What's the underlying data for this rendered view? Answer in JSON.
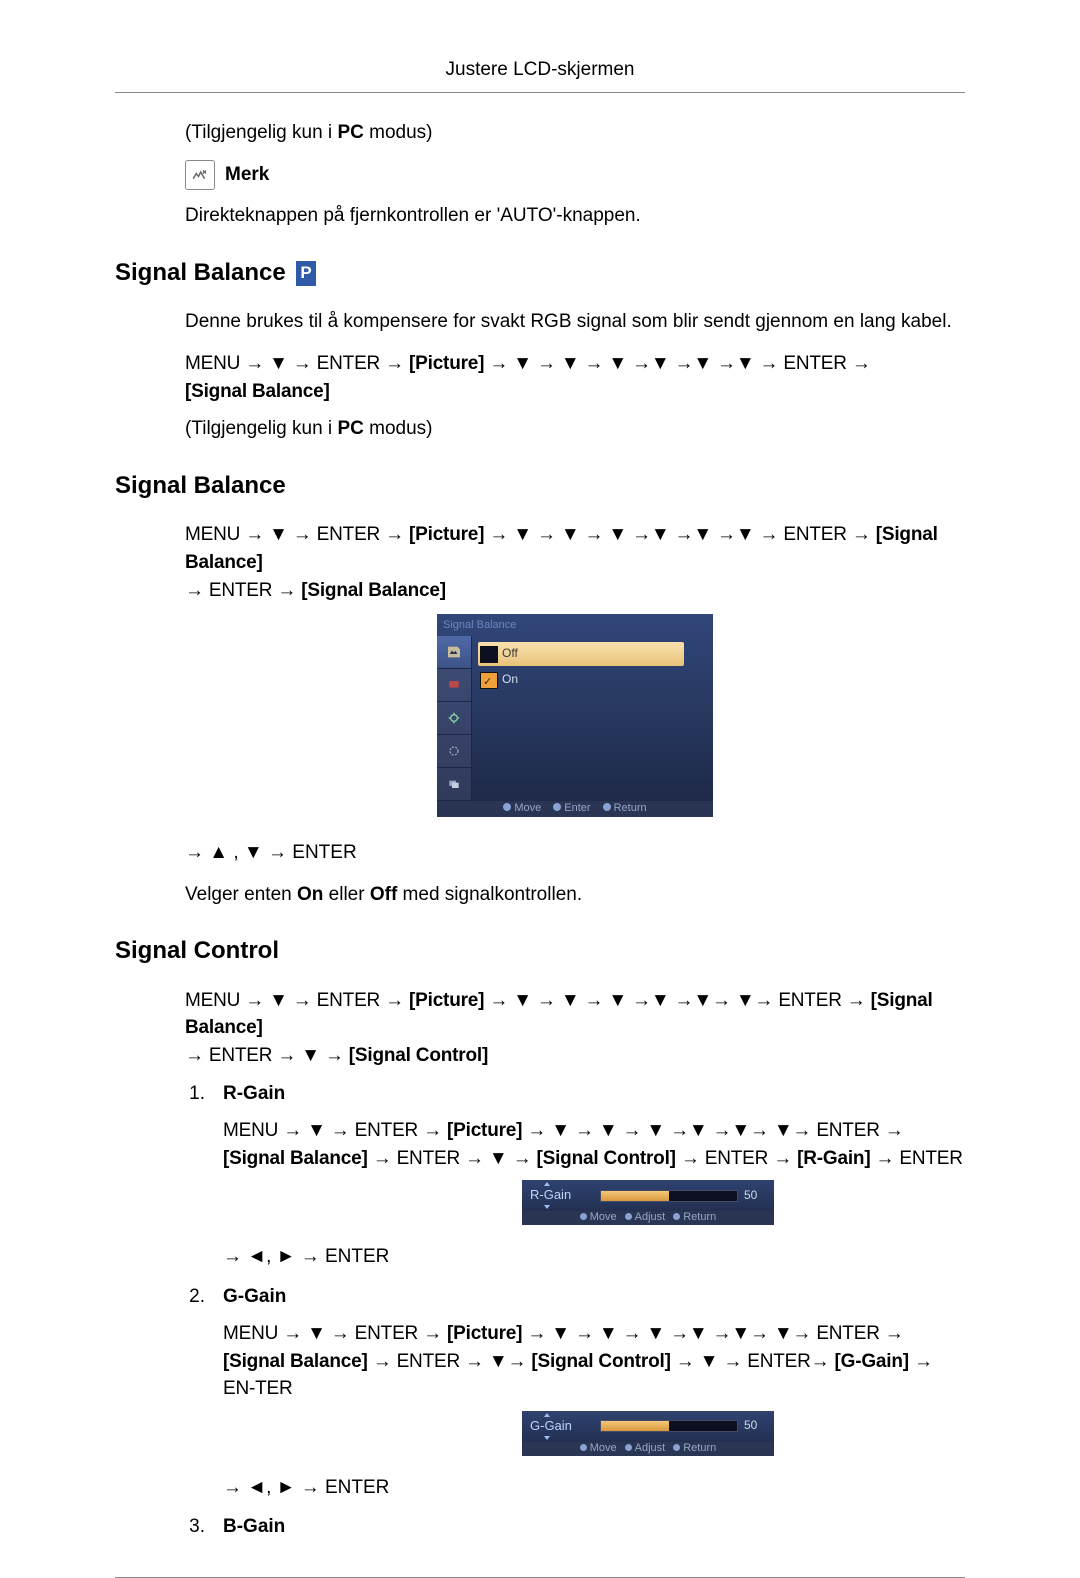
{
  "header": {
    "title": "Justere LCD-skjermen"
  },
  "intro": {
    "avail": "(Tilgjengelig kun i ",
    "pc": "PC",
    "avail_end": " modus)",
    "note_label": "Merk",
    "direct_btn": "Direkteknappen på fjernkontrollen er 'AUTO'-knappen."
  },
  "sec1": {
    "heading": "Signal Balance",
    "p_icon": "P",
    "desc": "Denne brukes til å kompensere for svakt RGB signal som blir sendt gjennom en lang kabel.",
    "seq_a": "MENU  →  ▼  →  ENTER  →  ",
    "seq_pic": "[Picture]",
    "seq_b": "  →  ▼  →  ▼  →  ▼  →▼  →▼  →▼  →  ENTER  → ",
    "seq_sb": "[Signal Balance]",
    "avail": "(Tilgjengelig kun i ",
    "pc": "PC",
    "avail_end": " modus)"
  },
  "sec2": {
    "heading": "Signal Balance",
    "seq_a": "MENU → ▼ → ENTER → ",
    "seq_pic": "[Picture]",
    "seq_b": " → ▼ → ▼ → ▼ →▼ →▼ →▼ → ENTER → ",
    "seq_sb": "[Signal Balance]",
    "seq_c": " → ENTER → ",
    "seq_sb2": "[Signal Balance]",
    "menu_title": "Signal Balance",
    "off": "Off",
    "on": "On",
    "foot_move": "Move",
    "foot_enter": "Enter",
    "foot_return": "Return",
    "nav_end": "→ ▲ , ▼ → ENTER",
    "choose_a": "Velger enten ",
    "choose_on": "On",
    "choose_mid": " eller ",
    "choose_off": "Off",
    "choose_b": " med signalkontrollen."
  },
  "sec3": {
    "heading": "Signal Control",
    "seq_a": "MENU → ▼ → ENTER → ",
    "seq_pic": "[Picture]",
    "seq_b": " → ▼ → ▼ → ▼ →▼ →▼→ ▼→ ENTER → ",
    "seq_sb": "[Signal Balance]",
    "seq_c": " → ENTER → ▼ → ",
    "seq_sc": "[Signal Control]",
    "item1_num": "1.",
    "item1_label": "R-Gain",
    "item1_seq_a": "MENU  →  ▼  →  ENTER  →  ",
    "item1_seq_b": "  →  ▼  →  ▼  →  ▼  →▼  →▼→  ▼→  ENTER  → ",
    "item1_seq_c": " → ENTER → ▼ → ",
    "item1_seq_d": " → ENTER → ",
    "item1_rg": "[R-Gain]",
    "item1_seq_e": " → ENTER",
    "item1_mini_label": "R-Gain",
    "item1_mini_val": "50",
    "item1_end": "→ ◄, ► → ENTER",
    "item2_num": "2.",
    "item2_label": "G-Gain",
    "item2_seq_a": "MENU  →  ▼  →  ENTER  →  ",
    "item2_seq_b": "  →  ▼  →  ▼  →  ▼  →▼  →▼→  ▼→  ENTER  → ",
    "item2_seq_c": " → ENTER → ▼→ ",
    "item2_seq_d": " → ▼ → ENTER→ ",
    "item2_gg": "[G-Gain]",
    "item2_seq_e": " → EN-TER",
    "item2_mini_label": "G-Gain",
    "item2_mini_val": "50",
    "item2_end": "→ ◄, ► → ENTER",
    "item3_num": "3.",
    "item3_label": "B-Gain",
    "mini_foot_move": "Move",
    "mini_foot_adjust": "Adjust",
    "mini_foot_return": "Return"
  }
}
